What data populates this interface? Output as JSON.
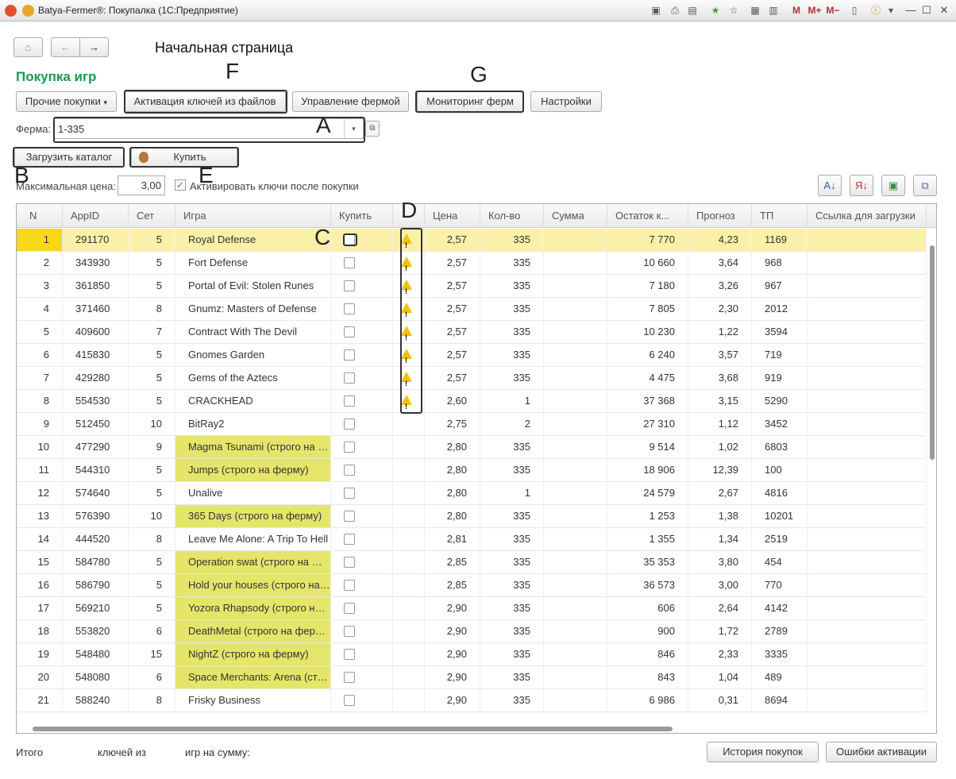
{
  "window": {
    "title": "Batya-Fermer®: Покупалка (1С:Предприятие)"
  },
  "nav": {
    "page_title": "Начальная страница"
  },
  "form": {
    "title": "Покупка игр",
    "buttons": {
      "other": "Прочие покупки",
      "activate": "Активация ключей из файлов",
      "farm": "Управление фермой",
      "monitor": "Мониторинг ферм",
      "settings": "Настройки",
      "load": "Загрузить каталог",
      "buy": "Купить"
    },
    "farm_label": "Ферма:",
    "farm_value": "1-335",
    "maxprice_label": "Максимальная цена:",
    "maxprice_value": "3,00",
    "activate_label": "Активировать ключи после покупки"
  },
  "annotations": {
    "A": "A",
    "B": "B",
    "C": "C",
    "D": "D",
    "E": "E",
    "F": "F",
    "G": "G"
  },
  "table": {
    "headers": [
      "N",
      "AppID",
      "Сет",
      "Игра",
      "Купить",
      "",
      "Цена",
      "Кол-во",
      "Сумма",
      "Остаток к...",
      "Прогноз",
      "ТП",
      "Ссылка для загрузки"
    ],
    "rows": [
      {
        "n": "1",
        "appid": "291170",
        "set": "5",
        "game": "Royal Defense",
        "warn": true,
        "price": "2,57",
        "qty": "335",
        "rest": "7 770",
        "prog": "4,23",
        "tp": "1169",
        "sel": true,
        "strict": false
      },
      {
        "n": "2",
        "appid": "343930",
        "set": "5",
        "game": "Fort Defense",
        "warn": true,
        "price": "2,57",
        "qty": "335",
        "rest": "10 660",
        "prog": "3,64",
        "tp": "968",
        "sel": false,
        "strict": false
      },
      {
        "n": "3",
        "appid": "361850",
        "set": "5",
        "game": "Portal of Evil: Stolen Runes",
        "warn": true,
        "price": "2,57",
        "qty": "335",
        "rest": "7 180",
        "prog": "3,26",
        "tp": "967",
        "sel": false,
        "strict": false
      },
      {
        "n": "4",
        "appid": "371460",
        "set": "8",
        "game": "Gnumz: Masters of Defense",
        "warn": true,
        "price": "2,57",
        "qty": "335",
        "rest": "7 805",
        "prog": "2,30",
        "tp": "2012",
        "sel": false,
        "strict": false
      },
      {
        "n": "5",
        "appid": "409600",
        "set": "7",
        "game": "Contract With The Devil",
        "warn": true,
        "price": "2,57",
        "qty": "335",
        "rest": "10 230",
        "prog": "1,22",
        "tp": "3594",
        "sel": false,
        "strict": false
      },
      {
        "n": "6",
        "appid": "415830",
        "set": "5",
        "game": "Gnomes Garden",
        "warn": true,
        "price": "2,57",
        "qty": "335",
        "rest": "6 240",
        "prog": "3,57",
        "tp": "719",
        "sel": false,
        "strict": false
      },
      {
        "n": "7",
        "appid": "429280",
        "set": "5",
        "game": "Gems of the Aztecs",
        "warn": true,
        "price": "2,57",
        "qty": "335",
        "rest": "4 475",
        "prog": "3,68",
        "tp": "919",
        "sel": false,
        "strict": false
      },
      {
        "n": "8",
        "appid": "554530",
        "set": "5",
        "game": "CRACKHEAD",
        "warn": true,
        "price": "2,60",
        "qty": "1",
        "rest": "37 368",
        "prog": "3,15",
        "tp": "5290",
        "sel": false,
        "strict": false
      },
      {
        "n": "9",
        "appid": "512450",
        "set": "10",
        "game": "BitRay2",
        "warn": false,
        "price": "2,75",
        "qty": "2",
        "rest": "27 310",
        "prog": "1,12",
        "tp": "3452",
        "sel": false,
        "strict": false
      },
      {
        "n": "10",
        "appid": "477290",
        "set": "9",
        "game": "Magma Tsunami  (строго на ферму)",
        "warn": false,
        "price": "2,80",
        "qty": "335",
        "rest": "9 514",
        "prog": "1,02",
        "tp": "6803",
        "sel": false,
        "strict": true
      },
      {
        "n": "11",
        "appid": "544310",
        "set": "5",
        "game": "Jumps  (строго на ферму)",
        "warn": false,
        "price": "2,80",
        "qty": "335",
        "rest": "18 906",
        "prog": "12,39",
        "tp": "100",
        "sel": false,
        "strict": true
      },
      {
        "n": "12",
        "appid": "574640",
        "set": "5",
        "game": "Unalive",
        "warn": false,
        "price": "2,80",
        "qty": "1",
        "rest": "24 579",
        "prog": "2,67",
        "tp": "4816",
        "sel": false,
        "strict": false
      },
      {
        "n": "13",
        "appid": "576390",
        "set": "10",
        "game": "365 Days  (строго на ферму)",
        "warn": false,
        "price": "2,80",
        "qty": "335",
        "rest": "1 253",
        "prog": "1,38",
        "tp": "10201",
        "sel": false,
        "strict": true
      },
      {
        "n": "14",
        "appid": "444520",
        "set": "8",
        "game": "Leave Me Alone: A Trip To Hell",
        "warn": false,
        "price": "2,81",
        "qty": "335",
        "rest": "1 355",
        "prog": "1,34",
        "tp": "2519",
        "sel": false,
        "strict": false
      },
      {
        "n": "15",
        "appid": "584780",
        "set": "5",
        "game": "Operation swat  (строго на ферму)",
        "warn": false,
        "price": "2,85",
        "qty": "335",
        "rest": "35 353",
        "prog": "3,80",
        "tp": "454",
        "sel": false,
        "strict": true
      },
      {
        "n": "16",
        "appid": "586790",
        "set": "5",
        "game": "Hold your houses  (строго на ферму)",
        "warn": false,
        "price": "2,85",
        "qty": "335",
        "rest": "36 573",
        "prog": "3,00",
        "tp": "770",
        "sel": false,
        "strict": true
      },
      {
        "n": "17",
        "appid": "569210",
        "set": "5",
        "game": "Yozora Rhapsody  (строго на ферму)",
        "warn": false,
        "price": "2,90",
        "qty": "335",
        "rest": "606",
        "prog": "2,64",
        "tp": "4142",
        "sel": false,
        "strict": true
      },
      {
        "n": "18",
        "appid": "553820",
        "set": "6",
        "game": "DeathMetal  (строго на ферму)",
        "warn": false,
        "price": "2,90",
        "qty": "335",
        "rest": "900",
        "prog": "1,72",
        "tp": "2789",
        "sel": false,
        "strict": true
      },
      {
        "n": "19",
        "appid": "548480",
        "set": "15",
        "game": "NightZ  (строго на ферму)",
        "warn": false,
        "price": "2,90",
        "qty": "335",
        "rest": "846",
        "prog": "2,33",
        "tp": "3335",
        "sel": false,
        "strict": true
      },
      {
        "n": "20",
        "appid": "548080",
        "set": "6",
        "game": "Space Merchants: Arena  (строго на ферму)",
        "warn": false,
        "price": "2,90",
        "qty": "335",
        "rest": "843",
        "prog": "1,04",
        "tp": "489",
        "sel": false,
        "strict": true
      },
      {
        "n": "21",
        "appid": "588240",
        "set": "8",
        "game": "Frisky Business",
        "warn": false,
        "price": "2,90",
        "qty": "335",
        "rest": "6 986",
        "prog": "0,31",
        "tp": "8694",
        "sel": false,
        "strict": false
      }
    ]
  },
  "footer": {
    "total": "Итого",
    "keys_from": "ключей из",
    "games_sum": "игр  на сумму:",
    "history": "История покупок",
    "errors": "Ошибки активации"
  },
  "colors": {
    "strict_bg": "#e5e56a",
    "selected_row": "#fbf0a8",
    "selected_n": "#f6d818",
    "title_green": "#1a9a4b"
  },
  "icons": [
    "back-arrow-icon",
    "forward-arrow-icon",
    "home-icon",
    "warning-icon",
    "money-bag-icon",
    "sort-asc-icon",
    "sort-desc-icon",
    "info-icon"
  ]
}
